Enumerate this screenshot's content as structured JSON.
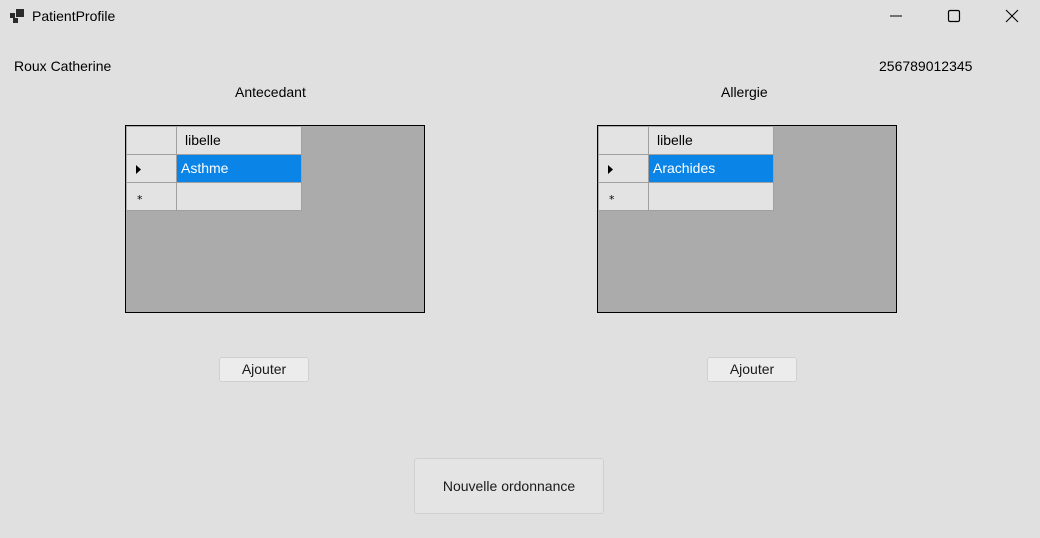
{
  "window": {
    "title": "PatientProfile",
    "minimize_icon": "minimize-icon",
    "maximize_icon": "maximize-icon",
    "close_icon": "close-icon"
  },
  "patient": {
    "name": "Roux Catherine",
    "number": "256789012345"
  },
  "antecedent": {
    "title": "Antecedant",
    "column_header": "libelle",
    "rows": [
      "Asthme"
    ],
    "add_label": "Ajouter"
  },
  "allergie": {
    "title": "Allergie",
    "column_header": "libelle",
    "rows": [
      "Arachides"
    ],
    "add_label": "Ajouter"
  },
  "new_prescription_label": "Nouvelle ordonnance",
  "colors": {
    "background": "#e0e0e0",
    "selection": "#0a84e6",
    "grid_background": "#ababab"
  }
}
